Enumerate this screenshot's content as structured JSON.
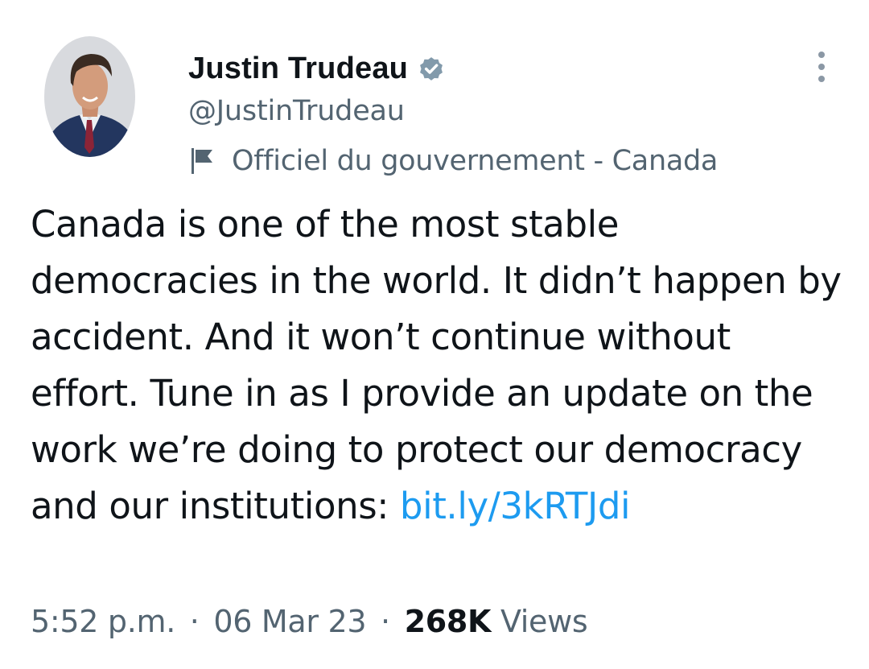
{
  "author": {
    "display_name": "Justin Trudeau",
    "handle": "@JustinTrudeau",
    "verified": true,
    "verified_icon": "verified-badge-icon",
    "label_icon": "flag-icon",
    "label": "Officiel du gouvernement - Canada"
  },
  "tweet": {
    "text": "Canada is one of the most stable democracies in the world. It didn’t happen by accident. And it won’t continue without effort. Tune in as I provide an update on the work we’re doing to protect our democracy and our institutions: ",
    "link_text": "bit.ly/3kRTJdi"
  },
  "meta": {
    "time": "5:52 p.m.",
    "separator": "·",
    "date": "06 Mar 23",
    "views_count": "268K",
    "views_label": "Views"
  },
  "colors": {
    "text_primary": "#0f1419",
    "text_secondary": "#536471",
    "link": "#1d9bf0",
    "verified_badge": "#829aab"
  }
}
